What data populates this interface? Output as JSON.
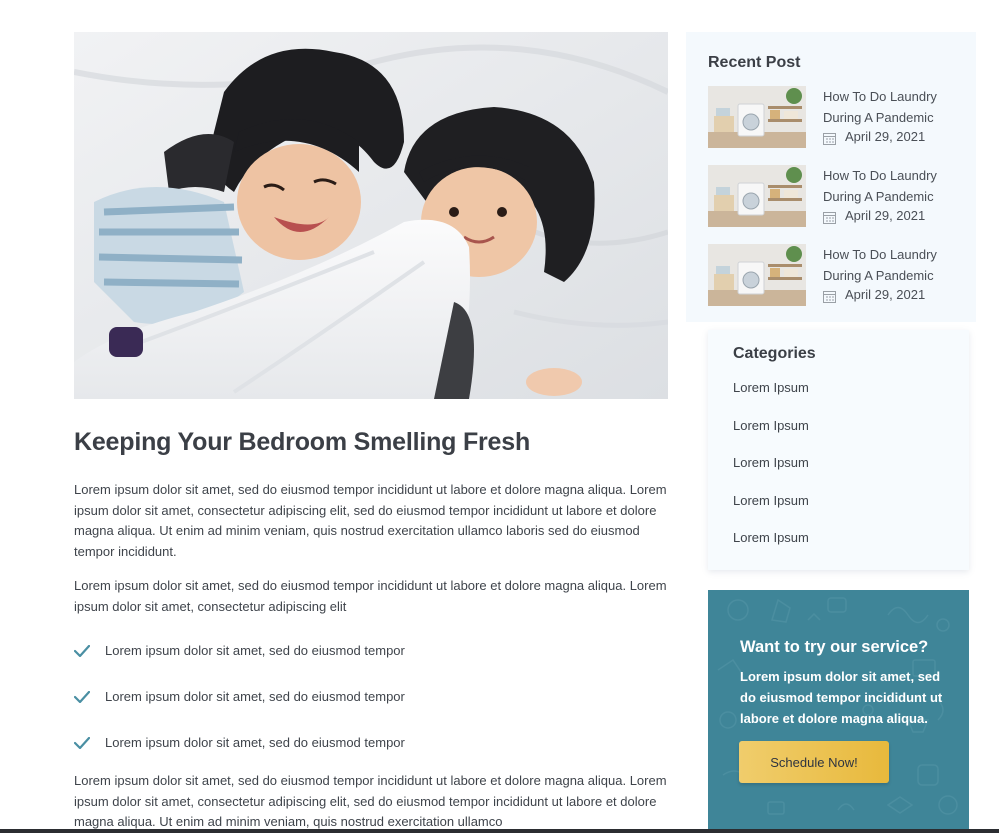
{
  "post": {
    "title": "Keeping Your Bedroom Smelling Fresh",
    "paragraph1": "Lorem ipsum dolor sit amet, sed do eiusmod tempor incididunt ut labore et dolore magna aliqua. Lorem ipsum dolor sit amet, consectetur adipiscing elit, sed do eiusmod tempor incididunt ut labore et dolore magna aliqua. Ut enim ad minim veniam, quis nostrud exercitation ullamco laboris sed do eiusmod tempor incididunt.",
    "paragraph2": "Lorem ipsum dolor sit amet, sed do eiusmod tempor incididunt ut labore et dolore magna aliqua. Lorem ipsum dolor sit amet, consectetur adipiscing elit",
    "checklist": [
      "Lorem ipsum dolor sit amet, sed do eiusmod tempor",
      "Lorem ipsum dolor sit amet, sed do eiusmod tempor",
      "Lorem ipsum dolor sit amet, sed do eiusmod tempor"
    ],
    "paragraph3": "Lorem ipsum dolor sit amet, sed do eiusmod tempor incididunt ut labore et dolore magna aliqua. Lorem ipsum dolor sit amet, consectetur adipiscing elit, sed do eiusmod tempor incididunt ut labore et dolore magna aliqua. Ut enim ad minim veniam, quis nostrud exercitation ullamco"
  },
  "sidebar": {
    "recent_title": "Recent Post",
    "recent_posts": [
      {
        "title": "How To Do Laundry During A Pandemic",
        "date": "April 29, 2021"
      },
      {
        "title": "How To Do Laundry During A Pandemic",
        "date": "April 29, 2021"
      },
      {
        "title": "How To Do Laundry During A Pandemic",
        "date": "April 29, 2021"
      }
    ],
    "categories_title": "Categories",
    "categories": [
      "Lorem Ipsum",
      "Lorem Ipsum",
      "Lorem Ipsum",
      "Lorem Ipsum",
      "Lorem Ipsum"
    ],
    "cta": {
      "title": "Want to try our service?",
      "text": "Lorem ipsum dolor sit amet, sed do eiusmod tempor incididunt ut labore et dolore magna aliqua.",
      "button_label": "Schedule Now!"
    }
  },
  "colors": {
    "accent_teal": "#3f8598",
    "check_teal": "#4a8fa3",
    "button_gold": "#e8b93c",
    "sidebar_bg": "#f4f9fd"
  },
  "icons": {
    "check": "check-icon",
    "calendar": "calendar-icon"
  }
}
